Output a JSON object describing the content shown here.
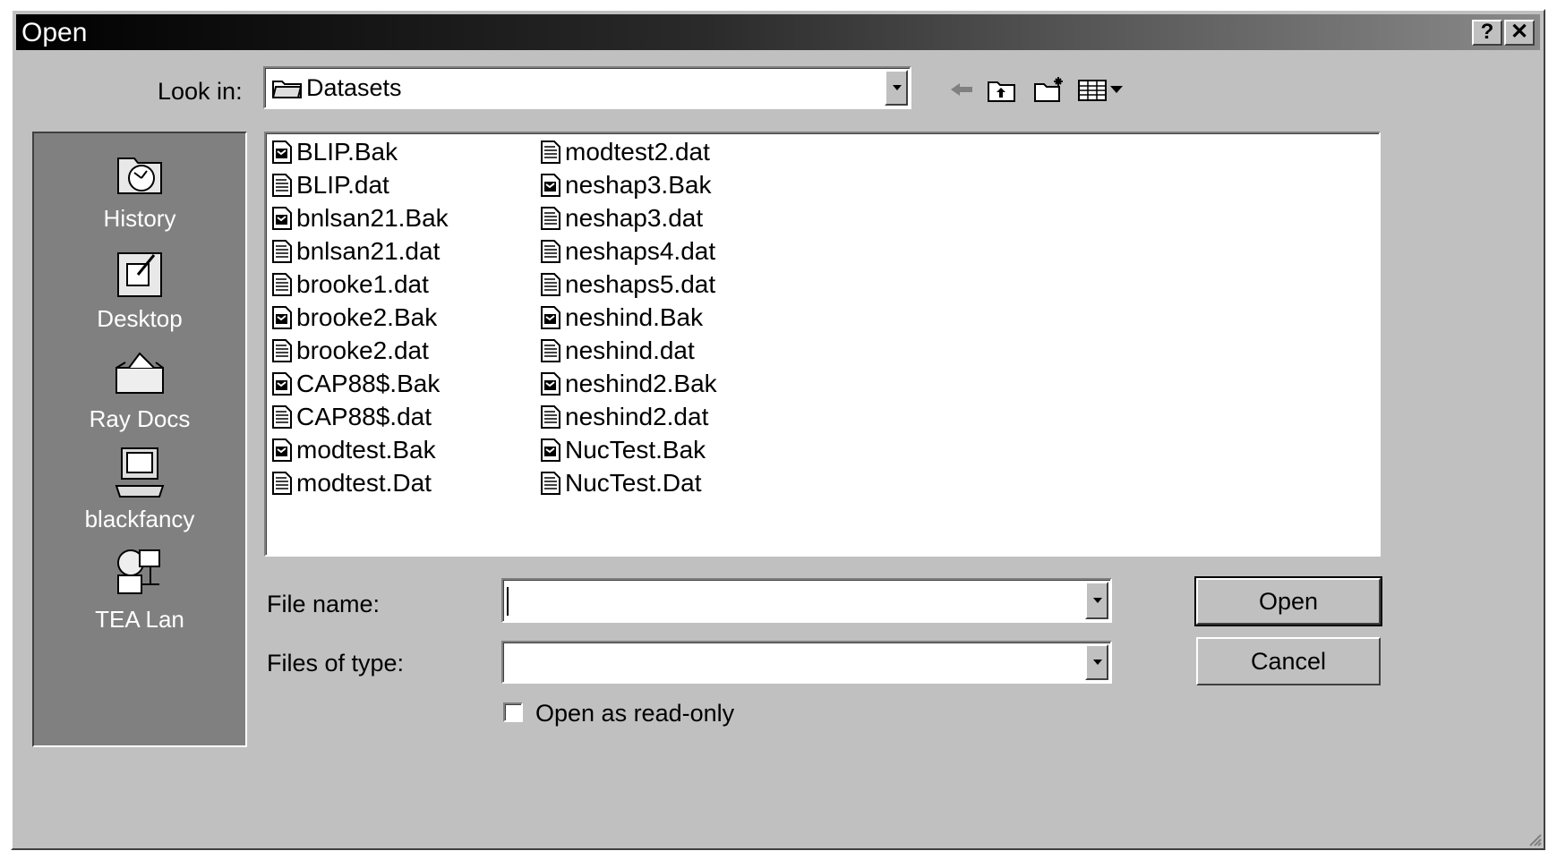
{
  "window": {
    "title": "Open",
    "help_label": "?",
    "close_label": "✕"
  },
  "lookin": {
    "label": "Look in:",
    "value": "Datasets"
  },
  "places": [
    {
      "label": "History",
      "icon": "history-icon"
    },
    {
      "label": "Desktop",
      "icon": "desktop-icon"
    },
    {
      "label": "Ray Docs",
      "icon": "documents-folder-icon"
    },
    {
      "label": "blackfancy",
      "icon": "computer-icon"
    },
    {
      "label": "TEA Lan",
      "icon": "network-icon"
    }
  ],
  "files": [
    {
      "name": "BLIP.Bak",
      "kind": "bak"
    },
    {
      "name": "BLIP.dat",
      "kind": "dat"
    },
    {
      "name": "bnlsan21.Bak",
      "kind": "bak"
    },
    {
      "name": "bnlsan21.dat",
      "kind": "dat"
    },
    {
      "name": "brooke1.dat",
      "kind": "dat"
    },
    {
      "name": "brooke2.Bak",
      "kind": "bak"
    },
    {
      "name": "brooke2.dat",
      "kind": "dat"
    },
    {
      "name": "CAP88$.Bak",
      "kind": "bak"
    },
    {
      "name": "CAP88$.dat",
      "kind": "dat"
    },
    {
      "name": "modtest.Bak",
      "kind": "bak"
    },
    {
      "name": "modtest.Dat",
      "kind": "dat"
    },
    {
      "name": "modtest2.dat",
      "kind": "dat"
    },
    {
      "name": "neshap3.Bak",
      "kind": "bak"
    },
    {
      "name": "neshap3.dat",
      "kind": "dat"
    },
    {
      "name": "neshaps4.dat",
      "kind": "dat"
    },
    {
      "name": "neshaps5.dat",
      "kind": "dat"
    },
    {
      "name": "neshind.Bak",
      "kind": "bak"
    },
    {
      "name": "neshind.dat",
      "kind": "dat"
    },
    {
      "name": "neshind2.Bak",
      "kind": "bak"
    },
    {
      "name": "neshind2.dat",
      "kind": "dat"
    },
    {
      "name": "NucTest.Bak",
      "kind": "bak"
    },
    {
      "name": "NucTest.Dat",
      "kind": "dat"
    }
  ],
  "filename": {
    "label": "File name:",
    "value": ""
  },
  "filetype": {
    "label": "Files of type:",
    "value": ""
  },
  "readonly": {
    "label": "Open as read-only",
    "checked": false
  },
  "buttons": {
    "open": "Open",
    "cancel": "Cancel"
  }
}
